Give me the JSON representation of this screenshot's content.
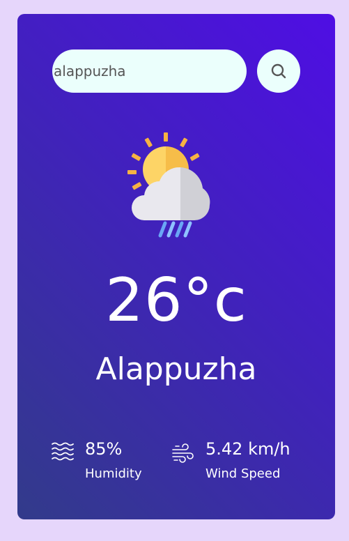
{
  "search": {
    "value": "alappuzha",
    "icon": "search-icon"
  },
  "weather": {
    "icon": "partly-cloudy-rain-icon",
    "temperature": "26°c",
    "city": "Alappuzha"
  },
  "details": {
    "humidity": {
      "icon": "humidity-waves-icon",
      "value": "85%",
      "label": "Humidity"
    },
    "wind": {
      "icon": "wind-icon",
      "value": "5.42 km/h",
      "label": "Wind Speed"
    }
  },
  "colors": {
    "page_background": "#e6d6fb",
    "card_gradient_start": "#4f0ee4",
    "card_gradient_end": "#323b8a",
    "input_background": "#ebfffc"
  }
}
